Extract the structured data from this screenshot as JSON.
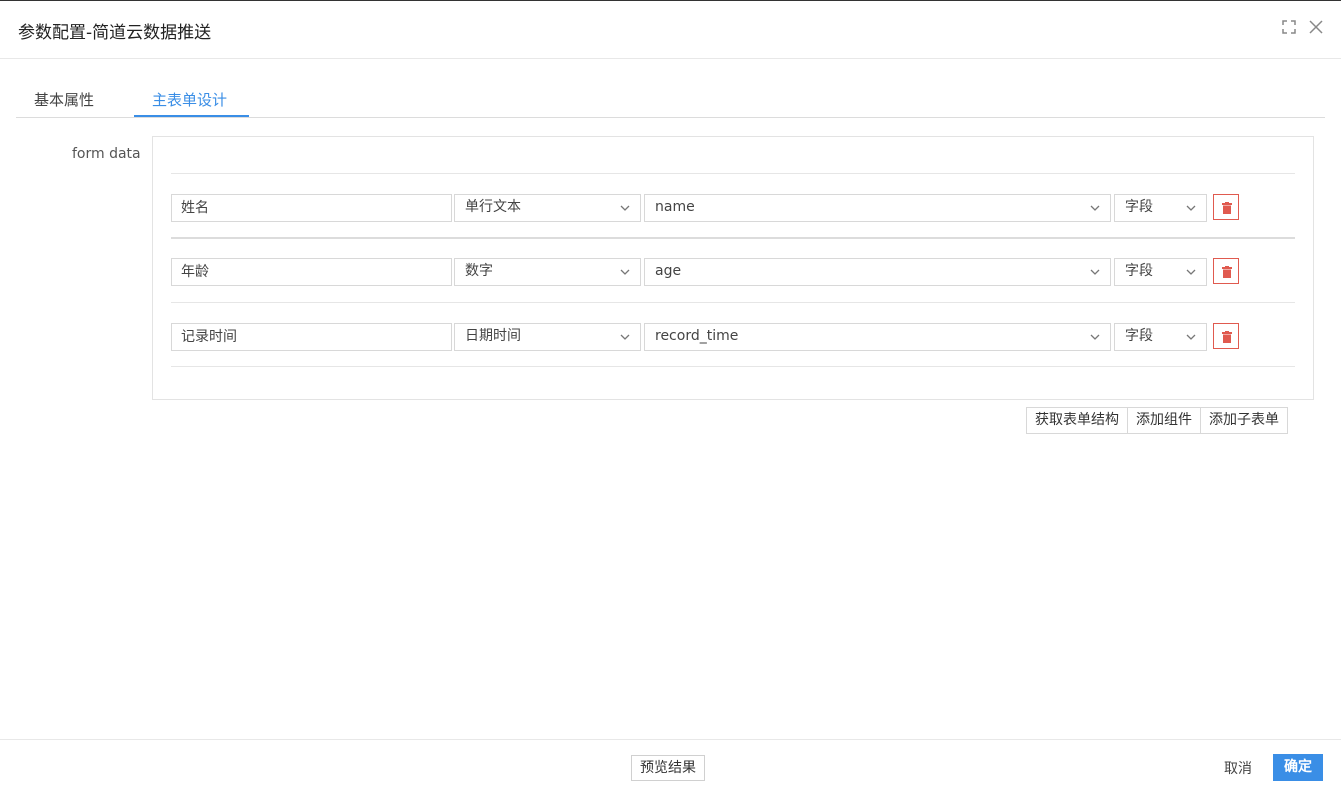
{
  "dialog": {
    "title": "参数配置-简道云数据推送",
    "icons": {
      "fullscreen": "fullscreen-icon",
      "close": "close-icon"
    }
  },
  "tabs": [
    {
      "label": "基本属性",
      "active": false
    },
    {
      "label": "主表单设计",
      "active": true
    }
  ],
  "form": {
    "label": "form data",
    "rows": [
      {
        "name": "姓名",
        "type": "单行文本",
        "key": "name",
        "source": "字段"
      },
      {
        "name": "年龄",
        "type": "数字",
        "key": "age",
        "source": "字段"
      },
      {
        "name": "记录时间",
        "type": "日期时间",
        "key": "record_time",
        "source": "字段"
      }
    ],
    "actions": [
      "获取表单结构",
      "添加组件",
      "添加子表单"
    ]
  },
  "footer": {
    "preview_label": "预览结果",
    "cancel_label": "取消",
    "ok_label": "确定"
  },
  "colors": {
    "accent": "#3a8ee6",
    "danger": "#e05a4f"
  }
}
